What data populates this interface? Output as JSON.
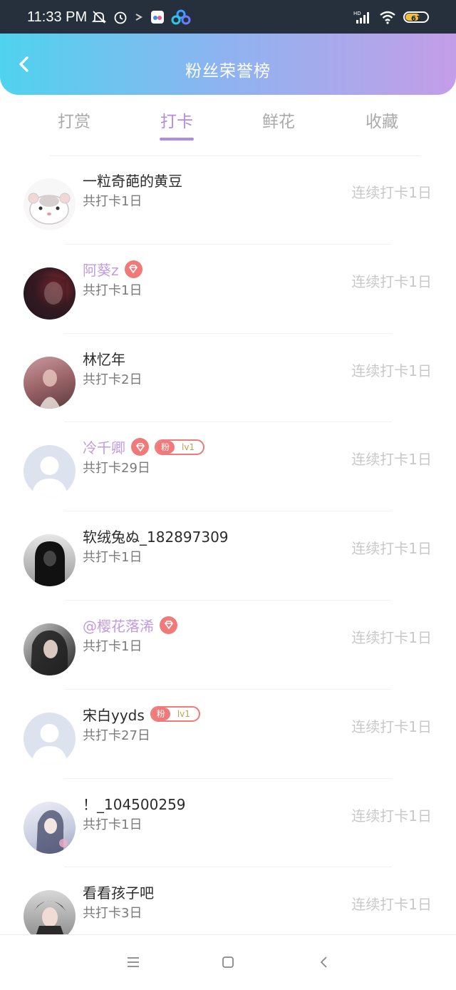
{
  "status_bar": {
    "time": "11:33 PM",
    "battery": "61",
    "icons": [
      "mute-icon",
      "alarm-icon",
      "arrow-icon",
      "app-icon",
      "cloud-icon",
      "signal-icon",
      "wifi-icon",
      "battery-icon"
    ]
  },
  "header": {
    "title": "粉丝荣誉榜"
  },
  "tabs": [
    {
      "label": "打赏",
      "active": false
    },
    {
      "label": "打卡",
      "active": true
    },
    {
      "label": "鲜花",
      "active": false
    },
    {
      "label": "收藏",
      "active": false
    }
  ],
  "rows": [
    {
      "name": "一粒奇葩的黄豆",
      "total": "共打卡1日",
      "streak": "连续打卡1日"
    },
    {
      "name": "阿葵z",
      "total": "共打卡1日",
      "streak": "连续打卡1日"
    },
    {
      "name": "林忆年",
      "total": "共打卡2日",
      "streak": "连续打卡1日"
    },
    {
      "name": "冷千卿",
      "total": "共打卡29日",
      "streak": "连续打卡1日",
      "fan_badge": {
        "label": "粉",
        "level": "lv1"
      }
    },
    {
      "name": "软绒兔ぬ_182897309",
      "total": "共打卡1日",
      "streak": "连续打卡1日"
    },
    {
      "name": "@樱花落浠",
      "total": "共打卡1日",
      "streak": "连续打卡1日"
    },
    {
      "name": "宋白yyds",
      "total": "共打卡27日",
      "streak": "连续打卡1日",
      "fan_badge": {
        "label": "粉",
        "level": "lv1"
      }
    },
    {
      "name": "！_104500259",
      "total": "共打卡1日",
      "streak": "连续打卡1日"
    },
    {
      "name": "看看孩子吧",
      "total": "共打卡3日",
      "streak": "连续打卡1日"
    }
  ],
  "colors": {
    "accent": "#b58be0",
    "vip_name": "#c29be0",
    "badge": "#f07a7a",
    "header_gradient": [
      "#4fd3ee",
      "#c49ee8"
    ]
  }
}
